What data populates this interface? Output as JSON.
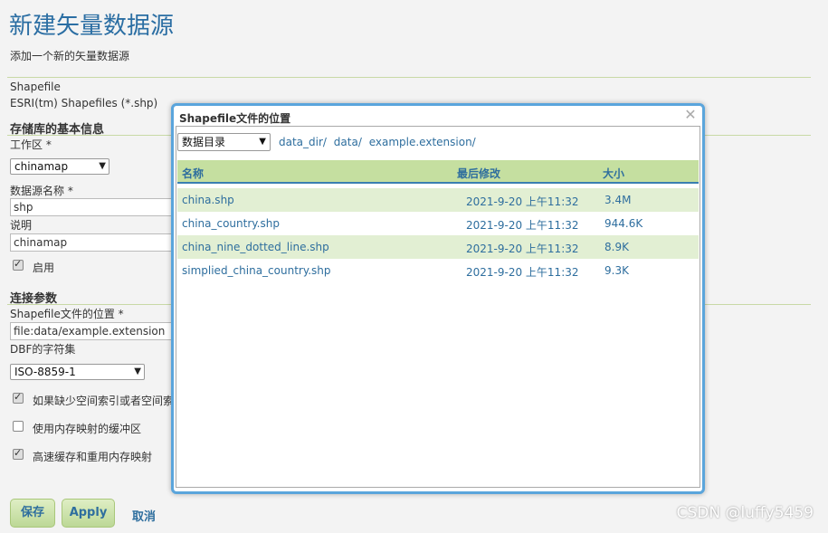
{
  "page": {
    "title": "新建矢量数据源",
    "subtitle": "添加一个新的矢量数据源",
    "source_type": "Shapefile",
    "source_desc": "ESRI(tm) Shapefiles (*.shp)"
  },
  "basic": {
    "heading": "存储库的基本信息",
    "workspace_label": "工作区 *",
    "workspace_value": "chinamap",
    "name_label": "数据源名称 *",
    "name_value": "shp",
    "desc_label": "说明",
    "desc_value": "chinamap",
    "enabled_label": "启用"
  },
  "conn": {
    "heading": "连接参数",
    "location_label": "Shapefile文件的位置 *",
    "location_value": "file:data/example.extension",
    "charset_label": "DBF的字符集",
    "charset_value": "ISO-8859-1",
    "opt1_label": "如果缺少空间索引或者空间索",
    "opt2_label": "使用内存映射的缓冲区",
    "opt3_label": "高速缓存和重用内存映射"
  },
  "buttons": {
    "save": "保存",
    "apply": "Apply",
    "cancel": "取消"
  },
  "watermark": "CSDN @luffy5459",
  "dialog": {
    "title": "Shapefile文件的位置",
    "close": "✕",
    "dir_select": "数据目录",
    "breadcrumb": [
      "data_dir/",
      "data/",
      "example.extension/"
    ],
    "columns": {
      "name": "名称",
      "modified": "最后修改",
      "size": "大小"
    },
    "files": [
      {
        "name": "china.shp",
        "modified": "2021-9-20 上午11:32",
        "size": "3.4M"
      },
      {
        "name": "china_country.shp",
        "modified": "2021-9-20 上午11:32",
        "size": "944.6K"
      },
      {
        "name": "china_nine_dotted_line.shp",
        "modified": "2021-9-20 上午11:32",
        "size": "8.9K"
      },
      {
        "name": "simplied_china_country.shp",
        "modified": "2021-9-20 上午11:32",
        "size": "9.3K"
      }
    ]
  }
}
